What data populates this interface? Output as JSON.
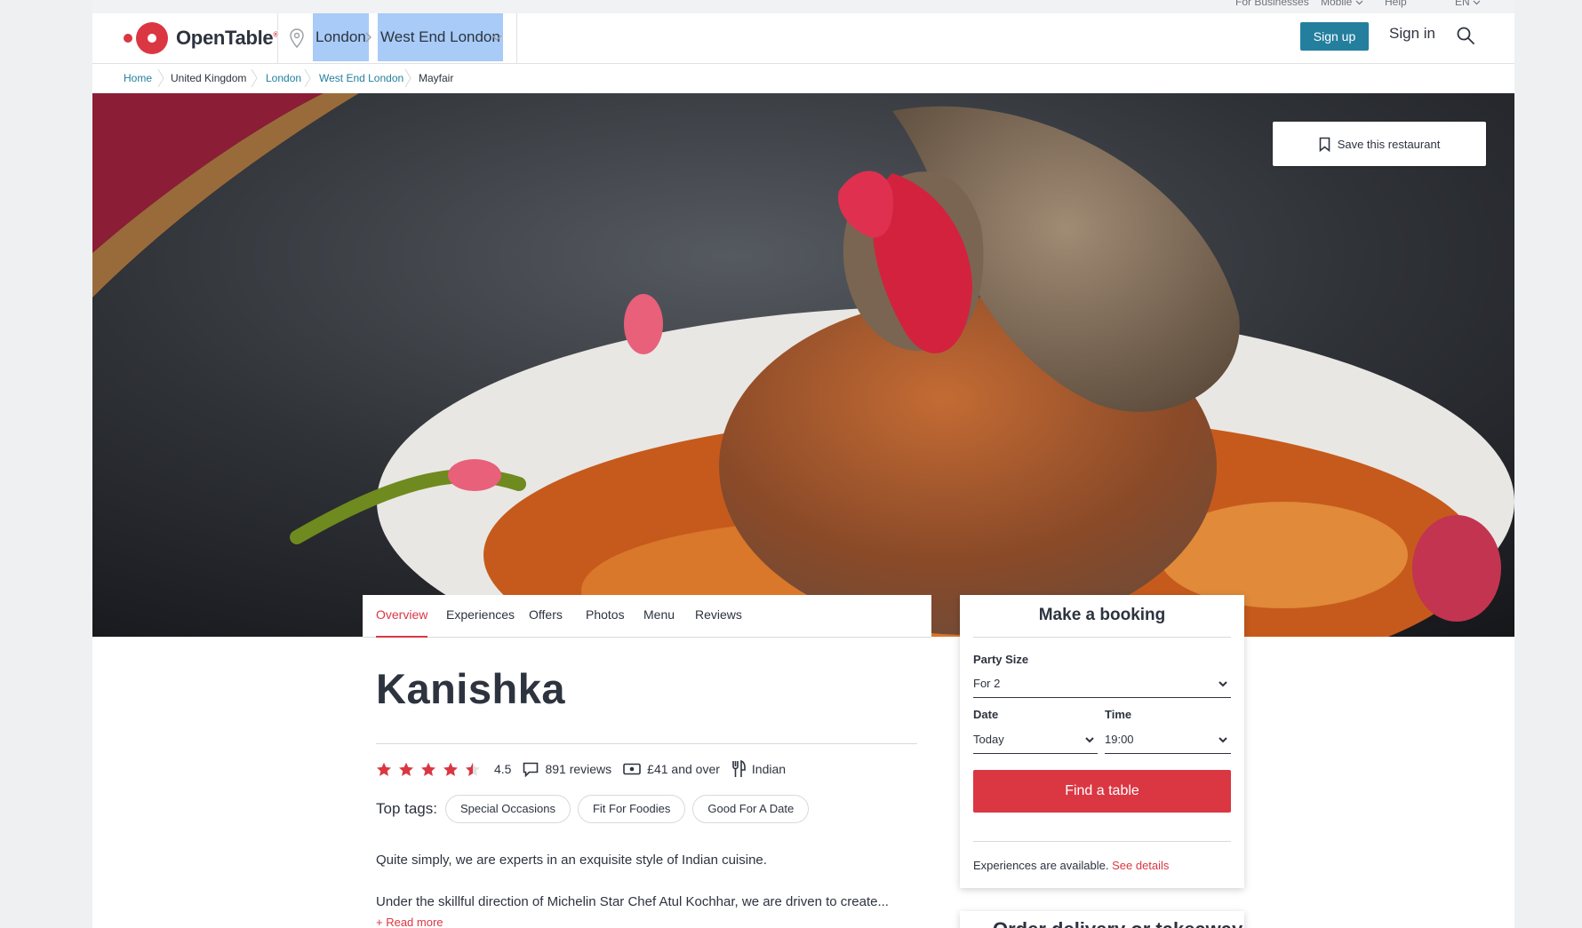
{
  "utility_bar": {
    "for_businesses": "For Businesses",
    "mobile": "Mobile",
    "help": "Help",
    "language": "EN"
  },
  "header": {
    "brand": "OpenTable",
    "location_city": "London",
    "location_area": "West End London",
    "signup_label": "Sign up",
    "signin_label": "Sign in"
  },
  "breadcrumb": {
    "items": [
      "Home",
      "United Kingdom",
      "London",
      "West End London",
      "Mayfair"
    ]
  },
  "hero": {
    "save_label": "Save this restaurant"
  },
  "tabs": [
    "Overview",
    "Experiences",
    "Offers",
    "Photos",
    "Menu",
    "Reviews"
  ],
  "restaurant": {
    "name": "Kanishka",
    "rating": "4.5",
    "rating_value": 4.5,
    "reviews": "891 reviews",
    "price": "£41 and over",
    "cuisine": "Indian",
    "top_tags_label": "Top tags:",
    "top_tags": [
      "Special Occasions",
      "Fit For Foodies",
      "Good For A Date"
    ],
    "description_1": "Quite simply, we are experts in an exquisite style of Indian cuisine.",
    "description_2": "Under the skillful direction of Michelin Star Chef Atul Kochhar, we are driven to create...",
    "read_more": "+ Read more"
  },
  "booking": {
    "title": "Make a booking",
    "party_size_label": "Party Size",
    "party_size_value": "For 2",
    "date_label": "Date",
    "date_value": "Today",
    "time_label": "Time",
    "time_value": "19:00",
    "find_button": "Find a table",
    "experiences_text": "Experiences are available.",
    "see_details": "See details"
  },
  "next_card": {
    "title": "Order delivery or takeaway"
  },
  "colors": {
    "brand_red": "#da3743",
    "teal": "#247f9e",
    "text": "#2d333f",
    "selection": "#a8cbf7"
  }
}
